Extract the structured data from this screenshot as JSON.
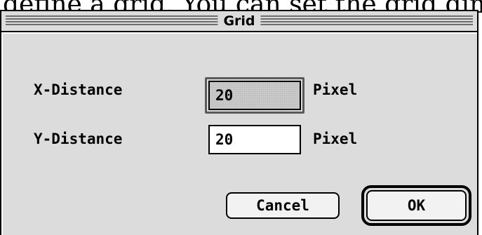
{
  "background_text": "define a grid.  You can set the grid dimensions fo",
  "window": {
    "title": "Grid"
  },
  "fields": [
    {
      "label": "X-Distance",
      "value": "20",
      "unit": "Pixel",
      "selected": true
    },
    {
      "label": "Y-Distance",
      "value": "20",
      "unit": "Pixel",
      "selected": false
    }
  ],
  "buttons": {
    "cancel": "Cancel",
    "ok": "OK"
  },
  "colors": {
    "dialog_bg": "#dcdcdc",
    "field_bg": "#ffffff",
    "border": "#000000"
  }
}
